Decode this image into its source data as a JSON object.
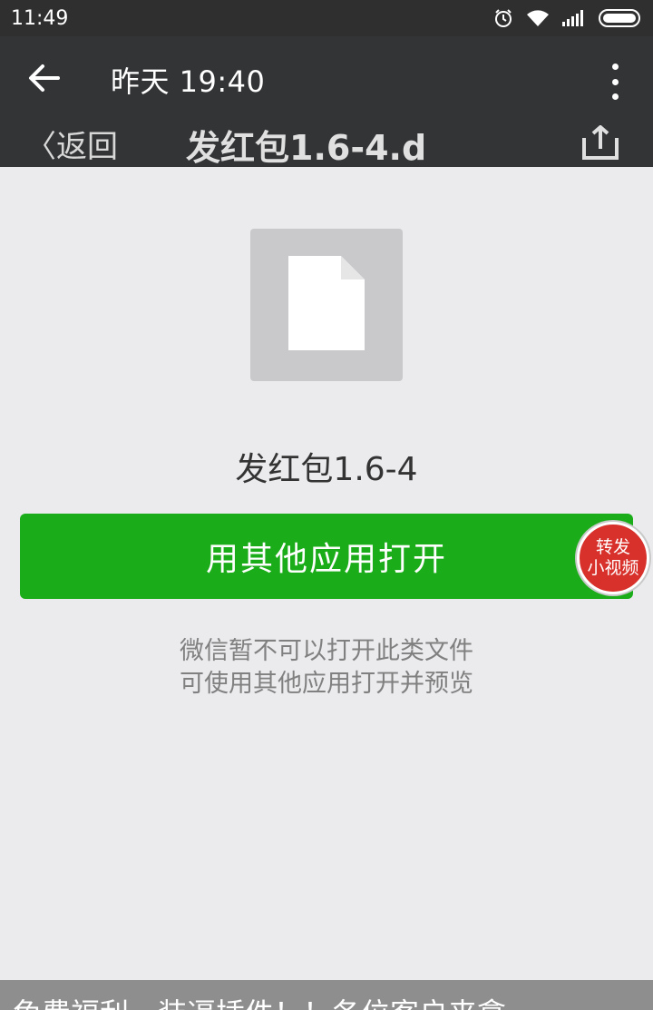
{
  "status_bar": {
    "time": "11:49",
    "icons": [
      "alarm-icon",
      "wifi-icon",
      "signal-icon",
      "battery-icon"
    ]
  },
  "toolbar": {
    "back_icon": "arrow-left-icon",
    "title": "昨天 19:40",
    "more_icon": "more-vertical-icon"
  },
  "ghost_header": {
    "back_label": "〈返回",
    "title": "发红包1.6-4.d",
    "share_icon": "share-icon"
  },
  "file": {
    "icon": "document-icon",
    "name": "发红包1.6-4"
  },
  "open_button": {
    "label": "用其他应用打开"
  },
  "forward_badge": {
    "line1": "转发",
    "line2": "小视频"
  },
  "hint": {
    "line1": "微信暂不可以打开此类文件",
    "line2": "可使用其他应用打开并预览"
  },
  "caption": {
    "text": "免费福利，装逼插件！！各位客户来拿"
  },
  "colors": {
    "accent_green": "#1aad19",
    "toolbar_bg": "#333436",
    "badge_red": "#d8302b",
    "page_bg": "#ebebee"
  }
}
